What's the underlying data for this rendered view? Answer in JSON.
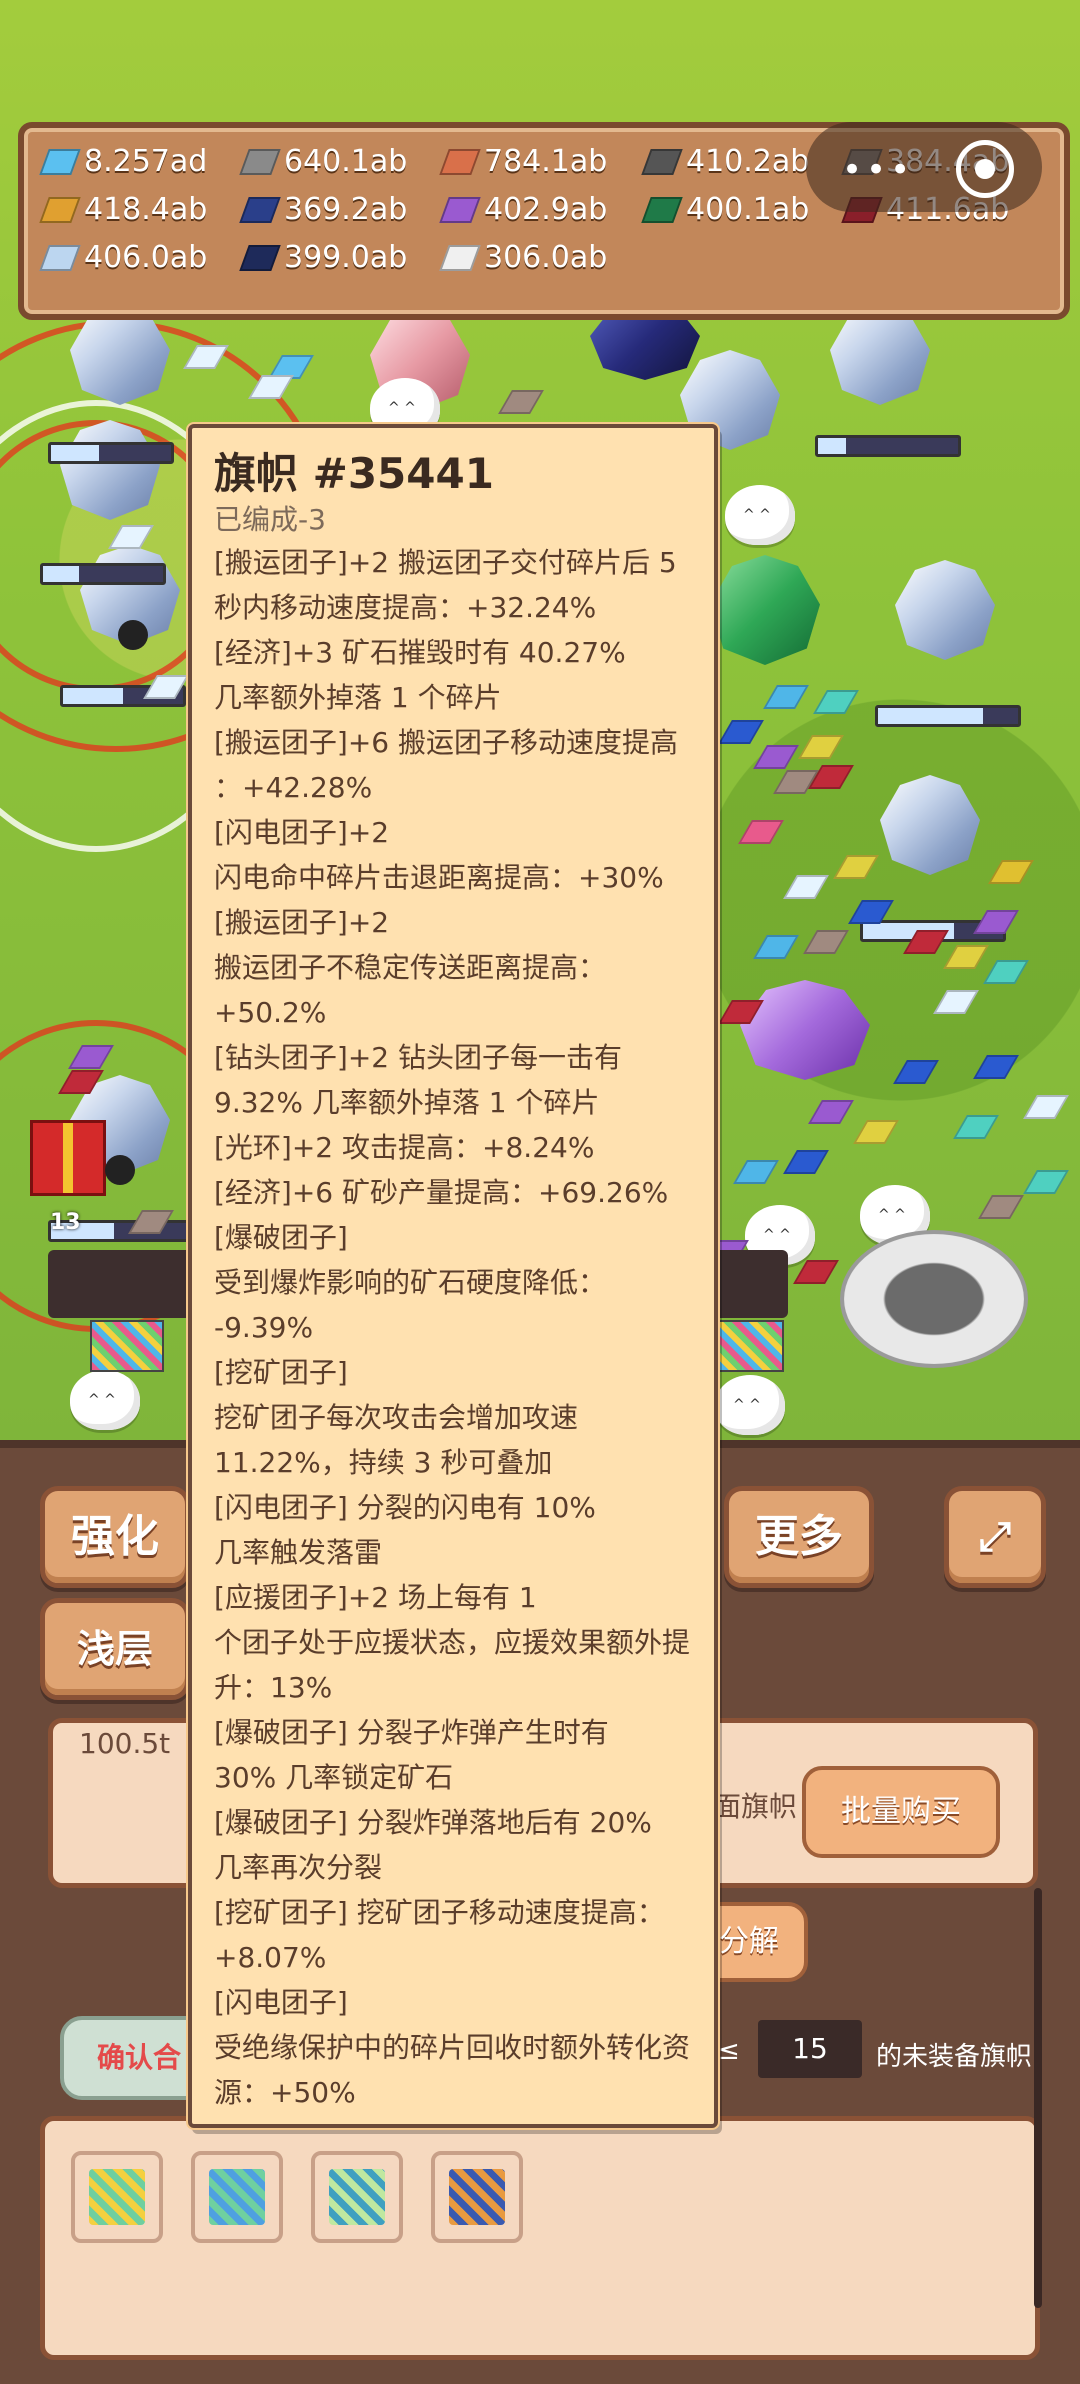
{
  "resources": [
    {
      "value": "8.257ad",
      "color": "#5bc0f0"
    },
    {
      "value": "640.1ab",
      "color": "#8a8a8a"
    },
    {
      "value": "784.1ab",
      "color": "#d9704a"
    },
    {
      "value": "410.2ab",
      "color": "#555555"
    },
    {
      "value": "384.4ab",
      "color": "#777777"
    },
    {
      "value": "418.4ab",
      "color": "#e0a030"
    },
    {
      "value": "369.2ab",
      "color": "#2a3f8a"
    },
    {
      "value": "402.9ab",
      "color": "#9a5ad0"
    },
    {
      "value": "400.1ab",
      "color": "#1f7a48"
    },
    {
      "value": "411.6ab",
      "color": "#8a1f2a"
    },
    {
      "value": "406.0ab",
      "color": "#bcd6f0"
    },
    {
      "value": "399.0ab",
      "color": "#1e2a5a"
    },
    {
      "value": "306.0ab",
      "color": "#f0f0f0"
    }
  ],
  "field": {
    "level_label": "13"
  },
  "tooltip": {
    "title": "旗帜 #35441",
    "subtitle": "已编成-3",
    "lines": [
      "[搬运团子]+2 搬运团子交付碎片后 5",
      "秒内移动速度提高：+32.24%",
      "[经济]+3 矿石摧毁时有 40.27%",
      "几率额外掉落 1 个碎片",
      "[搬运团子]+6 搬运团子移动速度提高",
      "：+42.28%",
      "[闪电团子]+2",
      "闪电命中碎片击退距离提高：+30%",
      "[搬运团子]+2",
      "搬运团子不稳定传送距离提高：",
      "+50.2%",
      "[钻头团子]+2 钻头团子每一击有",
      "9.32% 几率额外掉落 1 个碎片",
      "[光环]+2 攻击提高：+8.24%",
      "[经济]+6 矿砂产量提高：+69.26%",
      "[爆破团子]",
      "受到爆炸影响的矿石硬度降低：",
      "-9.39%",
      "[挖矿团子]",
      "挖矿团子每次攻击会增加攻速",
      "11.22%，持续 3 秒可叠加",
      "[闪电团子] 分裂的闪电有 10%",
      "几率触发落雷",
      "[应援团子]+2 场上每有 1",
      "个团子处于应援状态，应援效果额外提",
      "升：13%",
      "[爆破团子] 分裂子炸弹产生时有",
      "30% 几率锁定矿石",
      "[爆破团子] 分裂炸弹落地后有 20%",
      "几率再次分裂",
      "[挖矿团子] 挖矿团子移动速度提高：",
      "+8.07%",
      "[闪电团子]",
      "受绝缘保护中的碎片回收时额外转化资",
      "源：+50%"
    ]
  },
  "bottom": {
    "strengthen_label": "强化",
    "shallow_label": "浅层",
    "more_label": "更多",
    "cost_value": "100.5t",
    "flag_text": "面旗帜",
    "batch_buy_label": "批量购买",
    "decompose_label": "分解",
    "confirm_label": "确认合",
    "leq_symbol": "≤",
    "quality_value": "15",
    "unequipped_text": "的未装备旗帜",
    "slots": [
      {
        "icon": "rainbow-flag-icon",
        "c1": "#f4d03f",
        "c2": "#6fcf9f"
      },
      {
        "icon": "striped-flag-icon",
        "c1": "#6fd0a0",
        "c2": "#4fa0e0"
      },
      {
        "icon": "wave-flag-icon",
        "c1": "#bfe8a0",
        "c2": "#40a0c0"
      },
      {
        "icon": "blue-flag-icon",
        "c1": "#e89a40",
        "c2": "#3a5ab0"
      }
    ]
  }
}
